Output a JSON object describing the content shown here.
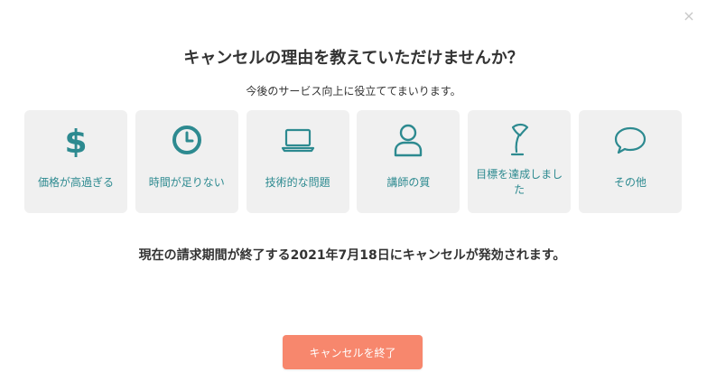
{
  "modal": {
    "close_label": "×",
    "title": "キャンセルの理由を教えていただけませんか？",
    "subtitle": "今後のサービス向上に役立ててまいります。",
    "options": [
      {
        "label": "価格が高過ぎる",
        "icon": "dollar-icon"
      },
      {
        "label": "時間が足りない",
        "icon": "clock-icon"
      },
      {
        "label": "技術的な問題",
        "icon": "laptop-icon"
      },
      {
        "label": "講師の質",
        "icon": "user-icon"
      },
      {
        "label": "目標を達成しました",
        "icon": "flag-icon"
      },
      {
        "label": "その他",
        "icon": "speech-bubble-icon"
      }
    ],
    "notice": "現在の請求期間が終了する2021年7月18日にキャンセルが発効されます。",
    "confirm_label": "キャンセルを終了"
  },
  "colors": {
    "accent": "#2d8a90",
    "button": "#f7876d",
    "tile": "#f0f0f0"
  }
}
